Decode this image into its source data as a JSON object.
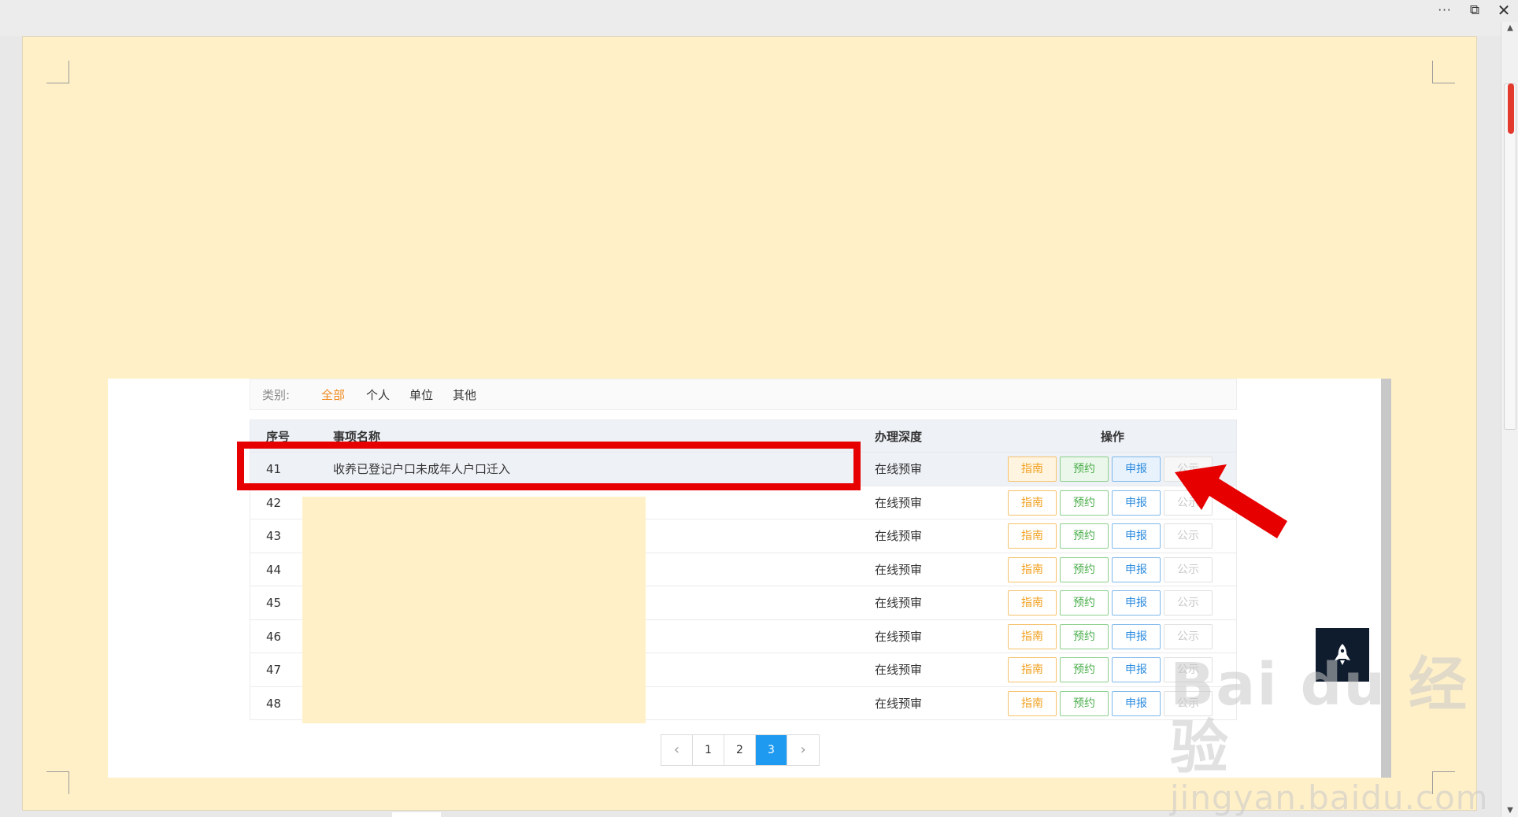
{
  "window": {
    "more_label": "···",
    "restore_label": "⧉",
    "close_label": "✕"
  },
  "filter": {
    "label": "类别:",
    "options": [
      "全部",
      "个人",
      "单位",
      "其他"
    ],
    "active": "全部"
  },
  "table": {
    "headers": {
      "no": "序号",
      "name": "事项名称",
      "depth": "办理深度",
      "operations": "操作"
    },
    "rows": [
      {
        "no": "41",
        "name": "收养已登记户口未成年人户口迁入",
        "depth": "在线预审",
        "highlighted": true
      },
      {
        "no": "42",
        "name": "",
        "depth": "在线预审"
      },
      {
        "no": "43",
        "name": "",
        "depth": "在线预审"
      },
      {
        "no": "44",
        "name": "",
        "depth": "在线预审"
      },
      {
        "no": "45",
        "name": "",
        "depth": "在线预审"
      },
      {
        "no": "46",
        "name": "",
        "depth": "在线预审"
      },
      {
        "no": "47",
        "name": "",
        "depth": "在线预审"
      },
      {
        "no": "48",
        "name": "",
        "depth": "在线预审"
      }
    ],
    "buttons": {
      "guide": "指南",
      "book": "预约",
      "apply": "申报",
      "publicity": "公示"
    }
  },
  "pagination": {
    "prev": "‹",
    "pages": [
      "1",
      "2",
      "3"
    ],
    "current": "3",
    "next": "›"
  },
  "watermark": {
    "brand": "Bai du 经验",
    "url": "jingyan.baidu.com"
  },
  "colors": {
    "page_background": "#fff0c8",
    "active_filter": "#f08a1e",
    "active_page": "#1e9bf0",
    "annotation_red": "#e60000",
    "rocket_bg": "#0f1c2e"
  },
  "icons": {
    "rocket": "rocket-icon",
    "annotation_arrow": "red-arrow-icon"
  }
}
